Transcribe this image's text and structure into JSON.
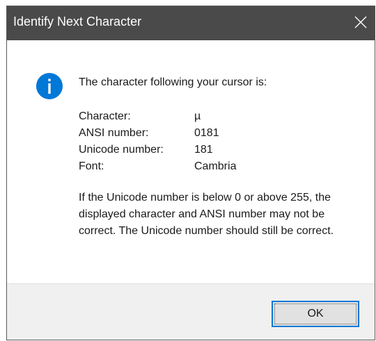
{
  "dialog": {
    "title": "Identify Next Character",
    "close_glyph": "✕",
    "icon": "info-icon",
    "intro": "The character following your cursor is:",
    "rows": [
      {
        "label": "Character:",
        "value": "µ"
      },
      {
        "label": "ANSI number:",
        "value": "0181"
      },
      {
        "label": "Unicode number:",
        "value": "181"
      },
      {
        "label": "Font:",
        "value": "Cambria"
      }
    ],
    "note": "If the Unicode number is below 0 or above 255, the displayed character and ANSI number may not be correct. The Unicode number should still be correct.",
    "ok_label": "OK"
  },
  "colors": {
    "titlebar": "#4a4a4a",
    "info_icon": "#0078d7",
    "button_border": "#0078d7",
    "footer": "#f0f0f0"
  }
}
